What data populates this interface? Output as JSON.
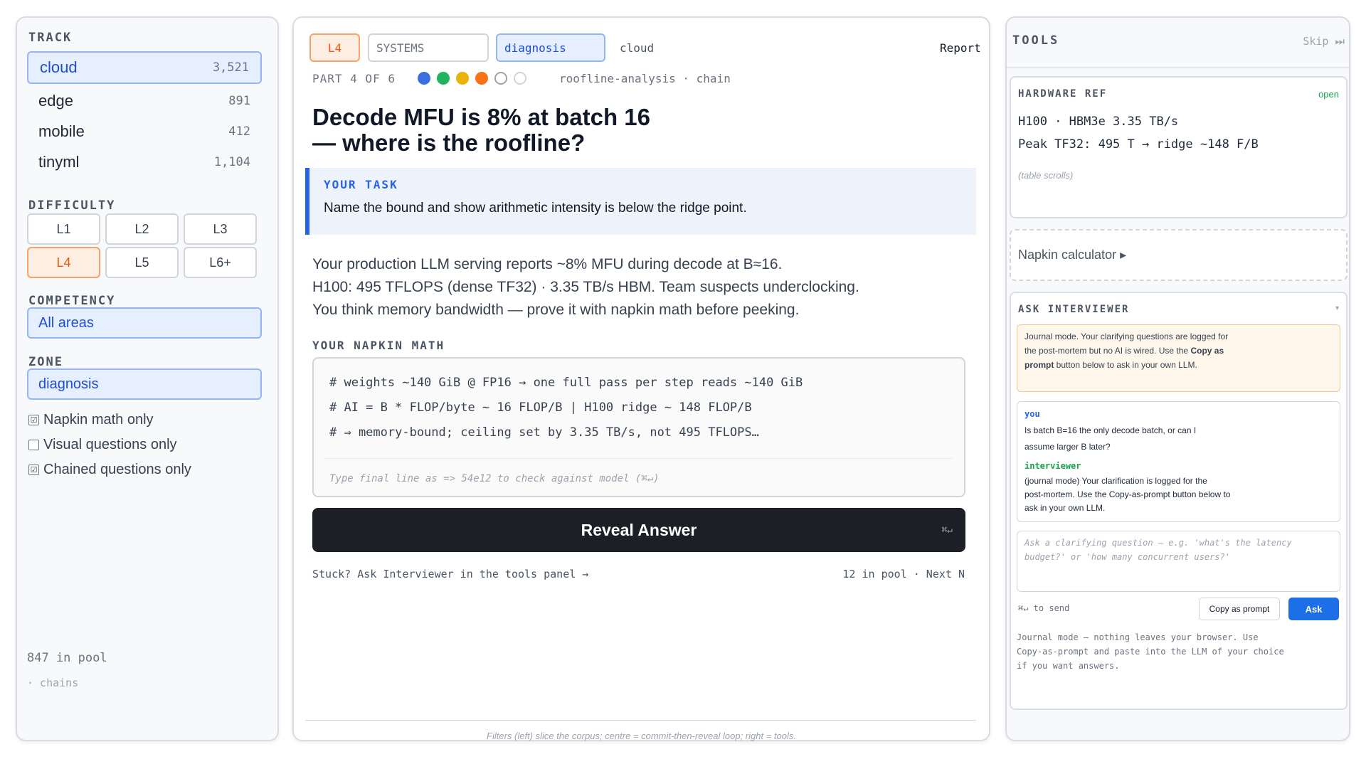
{
  "left": {
    "track_label": "TRACK",
    "tracks": [
      {
        "name": "cloud",
        "count": "3,521"
      },
      {
        "name": "edge",
        "count": "891"
      },
      {
        "name": "mobile",
        "count": "412"
      },
      {
        "name": "tinyml",
        "count": "1,104"
      }
    ],
    "difficulty_label": "DIFFICULTY",
    "difficulties": [
      "L1",
      "L2",
      "L3",
      "L4",
      "L5",
      "L6+"
    ],
    "competency_label": "COMPETENCY",
    "competency_value": "All areas",
    "zone_label": "ZONE",
    "zone_value": "diagnosis",
    "checks": [
      {
        "label": "Napkin math only",
        "checked": true
      },
      {
        "label": "Visual questions only",
        "checked": false
      },
      {
        "label": "Chained questions only",
        "checked": true
      }
    ],
    "pool_count": "847 in pool",
    "chains": "· chains"
  },
  "center": {
    "chip_level": "L4",
    "chip_systems": "SYSTEMS",
    "chip_diagnosis": "diagnosis",
    "chip_track": "cloud",
    "report": "Report",
    "part": "PART 4 OF 6",
    "progress_colors": [
      "#3b6fe0",
      "#22b35e",
      "#eab308",
      "#f97316"
    ],
    "chain_info": "roofline-analysis · chain",
    "title_line1": "Decode MFU is 8% at batch 16",
    "title_line2": "— where is the roofline?",
    "task_label": "YOUR TASK",
    "task_text": "Name the bound and show arithmetic intensity is below the ridge point.",
    "body_lines": [
      "Your production LLM serving reports ~8% MFU during decode at B≈16.",
      "H100: 495 TFLOPS (dense TF32) · 3.35 TB/s HBM. Team suspects underclocking.",
      "You think memory bandwidth — prove it with napkin math before peeking."
    ],
    "napkin_label": "YOUR NAPKIN MATH",
    "code_lines": [
      "# weights ~140 GiB @ FP16 → one full pass per step reads ~140 GiB",
      "# AI = B * FLOP/byte ~ 16 FLOP/B | H100 ridge ~ 148 FLOP/B",
      "# ⇒ memory-bound; ceiling set by 3.35 TB/s, not 495 TFLOPS…"
    ],
    "input_placeholder": "Type final line as => 54e12 to check against model (⌘↵)",
    "reveal_label": "Reveal Answer",
    "reveal_shortcut": "⌘↵",
    "stuck": "Stuck? Ask Interviewer in the tools panel →",
    "pool_next": "12 in pool · Next N",
    "footer": "Filters (left) slice the corpus; centre = commit-then-reveal loop; right = tools."
  },
  "right": {
    "tools_label": "TOOLS",
    "skip": "Skip ⏭",
    "hw_label": "HARDWARE REF",
    "hw_open": "open",
    "hw_line1": "H100 · HBM3e 3.35 TB/s",
    "hw_line2": "Peak TF32: 495 T → ridge ~148 F/B",
    "hw_note": "(table scrolls)",
    "napkin_calc": "Napkin calculator ▸",
    "ask_label": "ASK INTERVIEWER",
    "ask_caret": "▾",
    "notice_a": "Journal mode. Your clarifying questions are logged for",
    "notice_b": "the post-mortem but no AI is wired. Use the",
    "notice_bold1": "Copy as",
    "notice_bold2": "prompt",
    "notice_c": "button below to ask in your own LLM.",
    "you_label": "you",
    "you_line1": "Is batch B=16 the only decode batch, or can I",
    "you_line2": "assume larger B later?",
    "int_label": "interviewer",
    "int_line1": "(journal mode) Your clarification is logged for the",
    "int_line2": "post-mortem. Use the Copy-as-prompt button below to",
    "int_line3": "ask in your own LLM.",
    "ask_placeholder1": "Ask a clarifying question — e.g. 'what's the latency",
    "ask_placeholder2": "budget?' or 'how many concurrent users?'",
    "send_hint": "⌘↵ to send",
    "copy_btn": "Copy as prompt",
    "ask_btn": "Ask",
    "journal_1": "Journal mode — nothing leaves your browser. Use",
    "journal_2": "Copy-as-prompt and paste into the LLM of your choice",
    "journal_3": "if you want answers."
  }
}
